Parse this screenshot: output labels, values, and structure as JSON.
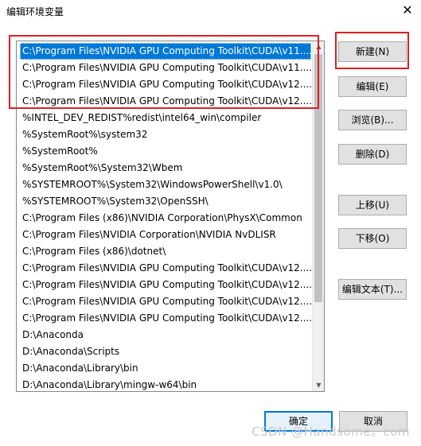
{
  "window": {
    "title": "编辑环境变量",
    "close_label": "✕"
  },
  "paths": [
    "C:\\Program Files\\NVIDIA GPU Computing Toolkit\\CUDA\\v11....",
    "C:\\Program Files\\NVIDIA GPU Computing Toolkit\\CUDA\\v11....",
    "C:\\Program Files\\NVIDIA GPU Computing Toolkit\\CUDA\\v12....",
    "C:\\Program Files\\NVIDIA GPU Computing Toolkit\\CUDA\\v12....",
    "%INTEL_DEV_REDIST%redist\\intel64_win\\compiler",
    "%SystemRoot%\\system32",
    "%SystemRoot%",
    "%SystemRoot%\\System32\\Wbem",
    "%SYSTEMROOT%\\System32\\WindowsPowerShell\\v1.0\\",
    "%SYSTEMROOT%\\System32\\OpenSSH\\",
    "C:\\Program Files (x86)\\NVIDIA Corporation\\PhysX\\Common",
    "C:\\Program Files\\NVIDIA Corporation\\NVIDIA NvDLISR",
    "C:\\Program Files (x86)\\dotnet\\",
    "C:\\Program Files\\NVIDIA GPU Computing Toolkit\\CUDA\\v12....",
    "C:\\Program Files\\NVIDIA GPU Computing Toolkit\\CUDA\\v12....",
    "C:\\Program Files\\NVIDIA GPU Computing Toolkit\\CUDA\\v12....",
    "C:\\Program Files\\NVIDIA GPU Computing Toolkit\\CUDA\\v12....",
    "D:\\Anaconda",
    "D:\\Anaconda\\Scripts",
    "D:\\Anaconda\\Library\\bin",
    "D:\\Anaconda\\Library\\mingw-w64\\bin"
  ],
  "selected_index": 0,
  "buttons": {
    "new": "新建(N)",
    "edit": "编辑(E)",
    "browse": "浏览(B)...",
    "delete": "删除(D)",
    "move_up": "上移(U)",
    "move_down": "下移(O)",
    "edit_text": "编辑文本(T)...",
    "ok": "确定",
    "cancel": "取消"
  },
  "scrollbar": {
    "up_icon": "triangle-up-icon",
    "down_icon": "triangle-down-icon"
  },
  "watermark": "CSDN @Handsome。com",
  "colors": {
    "selection": "#0078d7",
    "highlight_box": "#e02020"
  }
}
